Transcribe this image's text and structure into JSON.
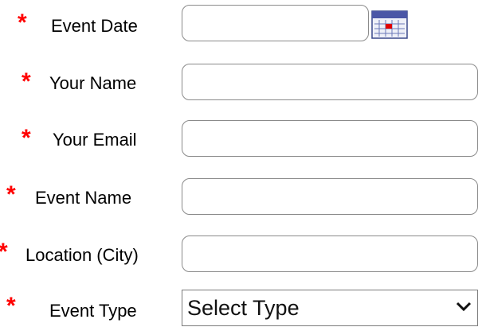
{
  "form": {
    "fields": [
      {
        "label": "Event Date",
        "required_mark": "*",
        "value": "",
        "placeholder": ""
      },
      {
        "label": "Your Name",
        "required_mark": "*",
        "value": "",
        "placeholder": ""
      },
      {
        "label": "Your Email",
        "required_mark": "*",
        "value": "",
        "placeholder": ""
      },
      {
        "label": "Event Name",
        "required_mark": "*",
        "value": "",
        "placeholder": ""
      },
      {
        "label": "Location (City)",
        "required_mark": "*",
        "value": "",
        "placeholder": ""
      },
      {
        "label": "Event Type",
        "required_mark": "*",
        "selected": "Select Type"
      }
    ],
    "icons": {
      "calendar": "calendar-icon",
      "dropdown": "chevron-down-icon"
    },
    "colors": {
      "required": "#ff0000",
      "border": "#8a8a8a",
      "calendar_header": "#4a56a6",
      "calendar_marker": "#e00000"
    }
  }
}
